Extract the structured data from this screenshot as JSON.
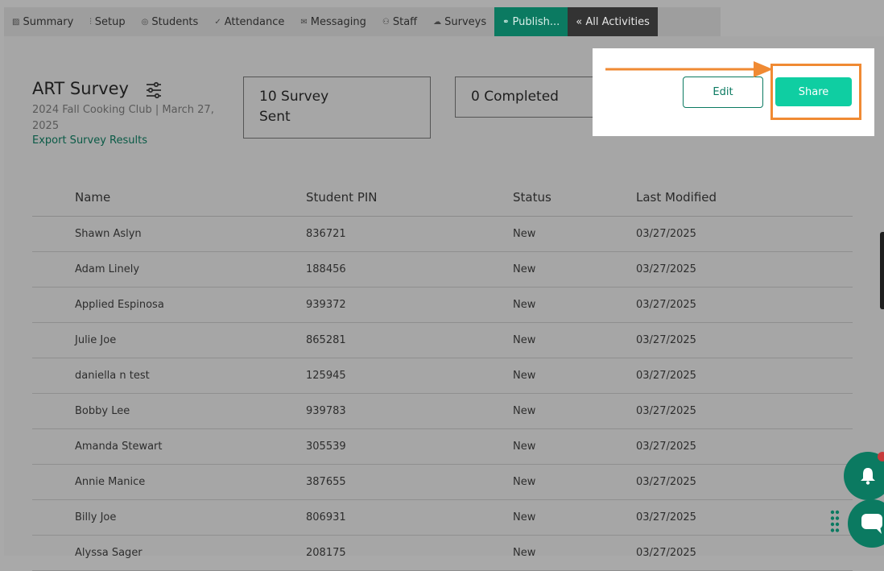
{
  "nav": {
    "tabs": [
      {
        "label": "Summary",
        "icon": "chart-icon"
      },
      {
        "label": "Setup",
        "icon": "sliders-icon"
      },
      {
        "label": "Students",
        "icon": "student-icon"
      },
      {
        "label": "Attendance",
        "icon": "check-icon"
      },
      {
        "label": "Messaging",
        "icon": "envelope-icon"
      },
      {
        "label": "Staff",
        "icon": "people-icon"
      },
      {
        "label": "Surveys",
        "icon": "cloud-icon"
      },
      {
        "label": "Publish...",
        "icon": "link-icon"
      },
      {
        "label": "« All Activities"
      }
    ]
  },
  "survey": {
    "title": "ART Survey",
    "subtitle": "2024 Fall Cooking Club | March 27, 2025",
    "export_label": "Export Survey Results",
    "sent_label": "10 Survey Sent",
    "completed_label": "0 Completed",
    "edit_label": "Edit",
    "share_label": "Share"
  },
  "table": {
    "headers": [
      "Name",
      "Student PIN",
      "Status",
      "Last Modified"
    ],
    "rows": [
      [
        "Shawn Aslyn",
        "836721",
        "New",
        "03/27/2025"
      ],
      [
        "Adam Linely",
        "188456",
        "New",
        "03/27/2025"
      ],
      [
        "Applied Espinosa",
        "939372",
        "New",
        "03/27/2025"
      ],
      [
        "Julie Joe",
        "865281",
        "New",
        "03/27/2025"
      ],
      [
        "daniella n test",
        "125945",
        "New",
        "03/27/2025"
      ],
      [
        "Bobby Lee",
        "939783",
        "New",
        "03/27/2025"
      ],
      [
        "Amanda Stewart",
        "305539",
        "New",
        "03/27/2025"
      ],
      [
        "Annie Manice",
        "387655",
        "New",
        "03/27/2025"
      ],
      [
        "Billy Joe",
        "806931",
        "New",
        "03/27/2025"
      ],
      [
        "Alyssa Sager",
        "208175",
        "New",
        "03/27/2025"
      ]
    ]
  },
  "colors": {
    "brand_green": "#0b7a61",
    "share_green": "#0fcea2",
    "highlight_orange": "#f08a33"
  }
}
